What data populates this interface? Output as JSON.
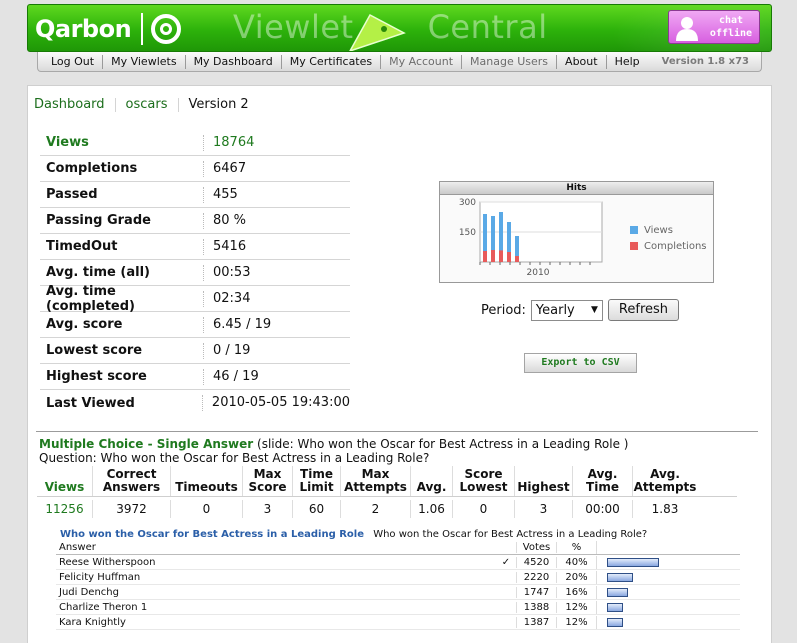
{
  "header": {
    "logo_text": "Qarbon",
    "brand_left": "Viewlet",
    "brand_right": "Central",
    "chat_line1": "chat",
    "chat_line2": "offline"
  },
  "nav": {
    "items": [
      {
        "label": "Log Out",
        "enabled": true
      },
      {
        "label": "My Viewlets",
        "enabled": true
      },
      {
        "label": "My Dashboard",
        "enabled": true
      },
      {
        "label": "My Certificates",
        "enabled": true
      },
      {
        "label": "My Account",
        "enabled": false
      },
      {
        "label": "Manage Users",
        "enabled": false
      },
      {
        "label": "About",
        "enabled": true
      },
      {
        "label": "Help",
        "enabled": true
      }
    ],
    "version": "Version 1.8 x73"
  },
  "breadcrumb": {
    "items": [
      "Dashboard",
      "oscars"
    ],
    "current": "Version 2"
  },
  "stats": [
    {
      "label": "Views",
      "value": "18764",
      "highlight": true
    },
    {
      "label": "Completions",
      "value": "6467"
    },
    {
      "label": "Passed",
      "value": "455"
    },
    {
      "label": "Passing Grade",
      "value": "80 %"
    },
    {
      "label": "TimedOut",
      "value": "5416"
    },
    {
      "label": "Avg. time (all)",
      "value": "00:53"
    },
    {
      "label": "Avg. time (completed)",
      "value": "02:34"
    },
    {
      "label": "Avg. score",
      "value": "6.45 / 19"
    },
    {
      "label": "Lowest score",
      "value": "0 / 19"
    },
    {
      "label": "Highest score",
      "value": "46 / 19"
    },
    {
      "label": "Last Viewed",
      "value": "2010-05-05 19:43:00"
    }
  ],
  "chart_data": {
    "type": "bar",
    "title": "Hits",
    "categories": [
      "1",
      "2",
      "3",
      "4",
      "5"
    ],
    "series": [
      {
        "name": "Views",
        "color": "#5aa9e6",
        "values": [
          240,
          230,
          250,
          200,
          130
        ]
      },
      {
        "name": "Completions",
        "color": "#e85a5a",
        "values": [
          55,
          60,
          58,
          50,
          30
        ]
      }
    ],
    "xlabel": "2010",
    "yticks": [
      150,
      300
    ],
    "ylim": [
      0,
      300
    ]
  },
  "controls": {
    "period_label": "Period:",
    "period_value": "Yearly",
    "refresh_label": "Refresh",
    "export_label": "Export to CSV"
  },
  "question": {
    "type": "Multiple Choice - Single Answer",
    "slide_text": "(slide: Who won the Oscar for Best Actress in a Leading Role )",
    "question_line": "Question: Who won the Oscar for Best Actress in a Leading Role?",
    "columns": [
      "Views",
      "Correct Answers",
      "Timeouts",
      "Max Score",
      "Time Limit",
      "Max Attempts",
      "Avg.",
      "Score Lowest",
      "Highest",
      "Avg. Time",
      "Avg. Attempts"
    ],
    "values": [
      "11256",
      "3972",
      "0",
      "3",
      "60",
      "2",
      "1.06",
      "0",
      "3",
      "00:00",
      "1.83"
    ]
  },
  "answers": {
    "title_link": "Who won the Oscar for Best Actress in a Leading Role",
    "title_text": "Who won the Oscar for Best Actress in a Leading Role?",
    "header": {
      "answer": "Answer",
      "votes": "Votes",
      "pct": "%"
    },
    "rows": [
      {
        "answer": "Reese Witherspoon",
        "correct": true,
        "votes": "4520",
        "pct": "40%",
        "fraction": 0.4
      },
      {
        "answer": "Felicity Huffman",
        "correct": false,
        "votes": "2220",
        "pct": "20%",
        "fraction": 0.2
      },
      {
        "answer": "Judi Denchg",
        "correct": false,
        "votes": "1747",
        "pct": "16%",
        "fraction": 0.16
      },
      {
        "answer": "Charlize Theron 1",
        "correct": false,
        "votes": "1388",
        "pct": "12%",
        "fraction": 0.12
      },
      {
        "answer": "Kara Knightly",
        "correct": false,
        "votes": "1387",
        "pct": "12%",
        "fraction": 0.12
      }
    ],
    "check_glyph": "✓"
  },
  "colors": {
    "header_green": "#2db20b",
    "link_green": "#1f7a1f",
    "chat_pink": "#d75fe0",
    "link_blue": "#2b5fa8"
  }
}
